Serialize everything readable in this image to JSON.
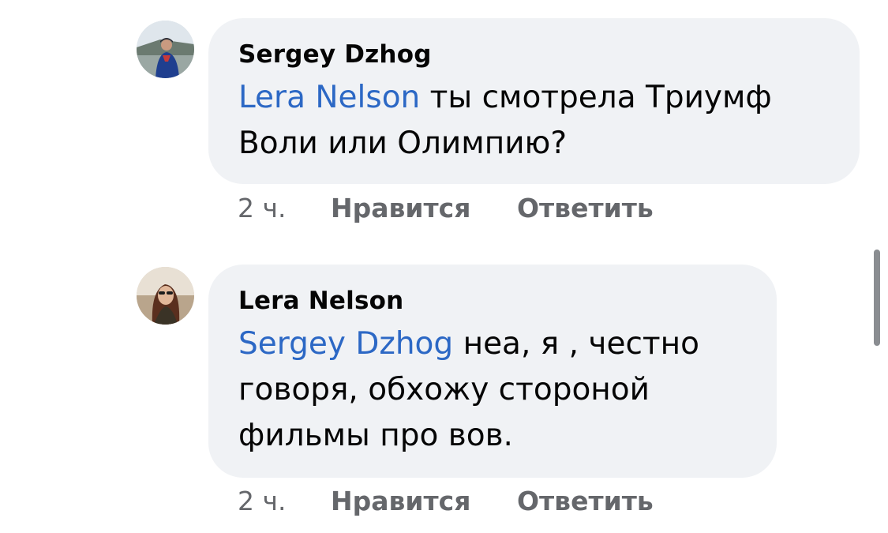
{
  "comments": [
    {
      "author": "Sergey Dzhog",
      "mention": "Lera Nelson",
      "text_line1": " ты смотрела Триумф",
      "text_line2": "Воли или Олимпию?",
      "time": "2 ч.",
      "like_label": "Нравится",
      "reply_label": "Ответить"
    },
    {
      "author": "Lera Nelson",
      "mention": "Sergey Dzhog",
      "text_line1": " неа, я , честно",
      "text_line2": "говоря, обхожу стороной",
      "text_line3": "фильмы про вов.",
      "time": "2 ч.",
      "like_label": "Нравится",
      "reply_label": "Ответить"
    }
  ],
  "colors": {
    "bubble_bg": "#f0f2f5",
    "mention": "#2c68c5",
    "meta_text": "#65676b",
    "body_text": "#050505"
  }
}
